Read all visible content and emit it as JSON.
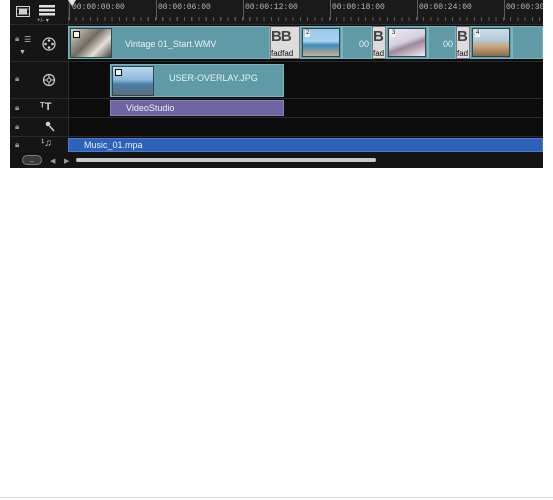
{
  "ruler": {
    "ticks": [
      "00:00:00:00",
      "00:00:06:00",
      "00:00:12:00",
      "00:00:18:00",
      "00:00:24:00",
      "00:00:30:00"
    ]
  },
  "tracks": {
    "video": {
      "clip1_label": "Vintage 01_Start.WMV",
      "transition_text": "fadfad",
      "clip_label_partial": "00",
      "fade_text": "fad",
      "clip_label_partial_2": "00",
      "badge_2": "2",
      "badge_3": "3",
      "badge_4": "4"
    },
    "overlay": {
      "clip_label": "USER-OVERLAY.JPG"
    },
    "title": {
      "clip_label": "VideoStudio"
    },
    "music": {
      "clip_label": "Music_01.mpa"
    }
  },
  "icons": [
    "storyboard-view-icon",
    "timeline-view-icon",
    "add-remove-track-icon",
    "video-track-icon",
    "overlay-track-icon",
    "title-track-icon",
    "voice-track-icon",
    "music-track-icon",
    "lock-icon",
    "scroll-left-icon",
    "scroll-right-icon",
    "fit-to-window-icon"
  ],
  "colors": {
    "video_clip": "#5f9aa6",
    "title_clip": "#6e64a0",
    "audio_clip": "#2e61b8",
    "background": "#0c0c0c"
  }
}
